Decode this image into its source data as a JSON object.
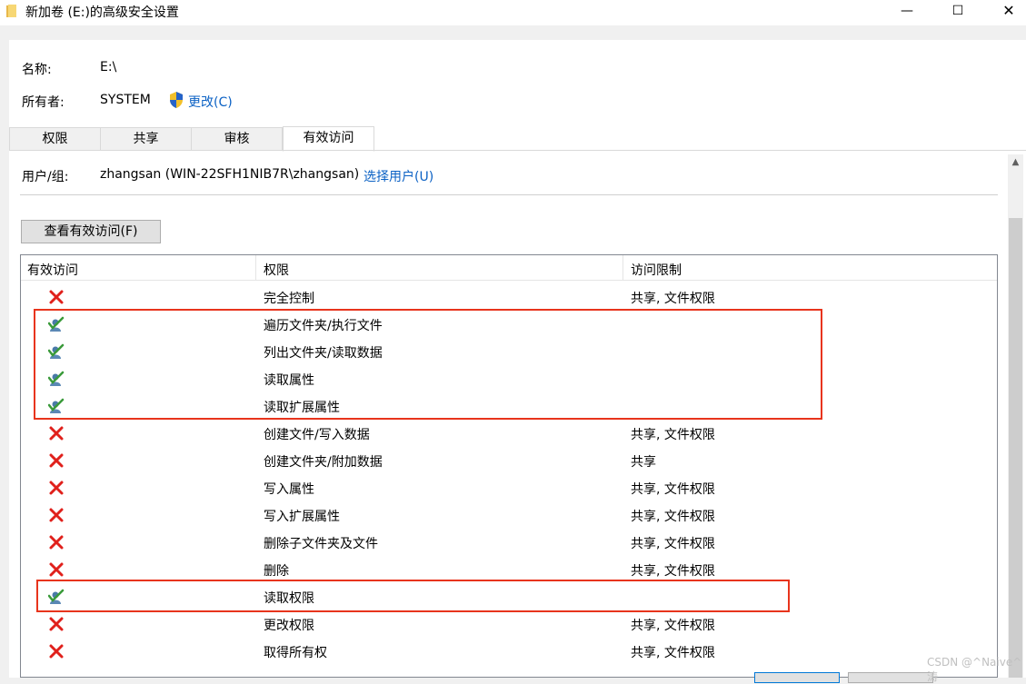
{
  "window": {
    "title": "新加卷 (E:)的高级安全设置",
    "minimize_glyph": "—",
    "maximize_glyph": "☐",
    "close_glyph": "✕"
  },
  "info": {
    "name_label": "名称:",
    "name_value": "E:\\",
    "owner_label": "所有者:",
    "owner_value": "SYSTEM",
    "change_link": "更改(C)"
  },
  "tabs": [
    {
      "label": "权限"
    },
    {
      "label": "共享"
    },
    {
      "label": "审核"
    },
    {
      "label": "有效访问",
      "active": true
    }
  ],
  "user": {
    "label": "用户/组:",
    "value": "zhangsan (WIN-22SFH1NIB7R\\zhangsan)",
    "select_link": "选择用户(U)"
  },
  "view_button": "查看有效访问(F)",
  "table": {
    "headers": [
      "有效访问",
      "权限",
      "访问限制"
    ],
    "rows": [
      {
        "access": "denied",
        "icon": "red-x-icon",
        "permission": "完全控制",
        "limit": "共享, 文件权限"
      },
      {
        "access": "allowed",
        "icon": "check-user-icon",
        "permission": "遍历文件夹/执行文件",
        "limit": ""
      },
      {
        "access": "allowed",
        "icon": "check-user-icon",
        "permission": "列出文件夹/读取数据",
        "limit": ""
      },
      {
        "access": "allowed",
        "icon": "check-user-icon",
        "permission": "读取属性",
        "limit": ""
      },
      {
        "access": "allowed",
        "icon": "check-user-icon",
        "permission": "读取扩展属性",
        "limit": ""
      },
      {
        "access": "denied",
        "icon": "red-x-icon",
        "permission": "创建文件/写入数据",
        "limit": "共享, 文件权限"
      },
      {
        "access": "denied",
        "icon": "red-x-icon",
        "permission": "创建文件夹/附加数据",
        "limit": "共享"
      },
      {
        "access": "denied",
        "icon": "red-x-icon",
        "permission": "写入属性",
        "limit": "共享, 文件权限"
      },
      {
        "access": "denied",
        "icon": "red-x-icon",
        "permission": "写入扩展属性",
        "limit": "共享, 文件权限"
      },
      {
        "access": "denied",
        "icon": "red-x-icon",
        "permission": "删除子文件夹及文件",
        "limit": "共享, 文件权限"
      },
      {
        "access": "denied",
        "icon": "red-x-icon",
        "permission": "删除",
        "limit": "共享, 文件权限"
      },
      {
        "access": "allowed",
        "icon": "check-user-icon",
        "permission": "读取权限",
        "limit": ""
      },
      {
        "access": "denied",
        "icon": "red-x-icon",
        "permission": "更改权限",
        "limit": "共享, 文件权限"
      },
      {
        "access": "denied",
        "icon": "red-x-icon",
        "permission": "取得所有权",
        "limit": "共享, 文件权限"
      }
    ]
  },
  "colors": {
    "highlight": "#e8341c",
    "deny": "#e0201b",
    "link": "#0b61c4",
    "allow": "#3a9a3a"
  },
  "watermark": "CSDN @^Naive^涛"
}
